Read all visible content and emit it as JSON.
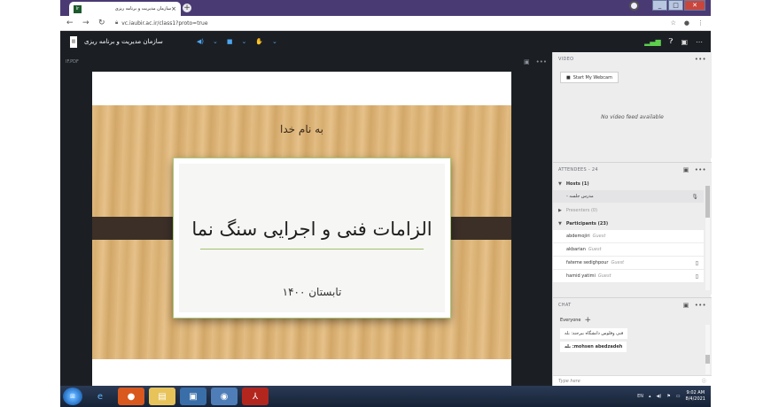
{
  "browser": {
    "tab_title": "سازمان مدیریت و برنامه ریزی",
    "tab_close": "×",
    "new_tab": "+",
    "favicon": "ir",
    "url": "vc.iaubir.ac.ir/class1?proto=true",
    "icons": [
      "back-icon",
      "forward-icon",
      "reload-icon",
      "lock-icon",
      "star-icon",
      "account-icon",
      "menu-icon"
    ]
  },
  "app": {
    "org_name": "سازمان مدیریت و برنامه ریزی",
    "audio_ctrl": "◀)",
    "video_ctrl": "■",
    "hand_ctrl": "✋",
    "chevron": "⌄"
  },
  "share_pod": {
    "label": "IF.PDF",
    "more": "•••"
  },
  "slide": {
    "heading": "به نام خدا",
    "title": "الزامات فنی و اجرایی سنگ نما",
    "date": "تابستان ۱۴۰۰"
  },
  "video_pod": {
    "label": "VIDEO",
    "more": "•••",
    "webcam_button": "Start My Webcam",
    "no_feed": "No video feed available"
  },
  "attendees_pod": {
    "label": "ATTENDEES - 24",
    "more": "•••",
    "hosts_label": "Hosts (1)",
    "host_name": "مدرس جلسه -",
    "presenters_label": "Presenters (0)",
    "participants_label": "Participants (23)",
    "guest_role": "Guest",
    "participants": [
      {
        "name": "abdemojiri",
        "role": "Guest"
      },
      {
        "name": "akbarian",
        "role": "Guest"
      },
      {
        "name": "fateme sedighpour",
        "role": "Guest"
      },
      {
        "name": "hamid yatimi",
        "role": "Guest"
      }
    ]
  },
  "chat_pod": {
    "label": "CHAT",
    "more": "•••",
    "recipient": "Everyone",
    "messages": [
      "فنی وفلوس دانشگاه بیرجند: بله",
      "mohsen abedzadeh: بله"
    ],
    "input_placeholder": "Type here"
  },
  "taskbar": {
    "lang": "EN",
    "time": "9:02 AM",
    "date": "8/4/2021"
  },
  "colors": {
    "app_header": "#1b1f24",
    "accent_blue": "#4ca5f0",
    "signal_green": "#5fcf4e",
    "slide_wood": "#dcb377",
    "card_border": "#a7c87a"
  }
}
